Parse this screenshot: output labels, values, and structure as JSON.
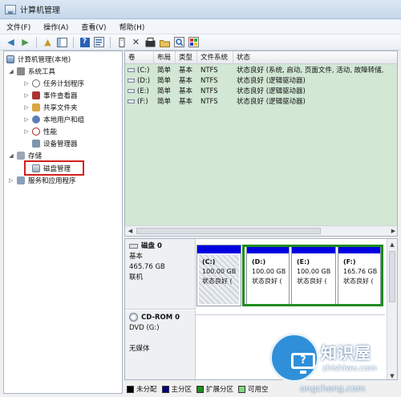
{
  "window": {
    "title": "计算机管理"
  },
  "menu": [
    "文件(F)",
    "操作(A)",
    "查看(V)",
    "帮助(H)"
  ],
  "toolbar": {
    "back": "back-arrow-icon",
    "forward": "forward-arrow-icon",
    "help_glyph": "?",
    "close_glyph": "✕"
  },
  "tree": {
    "root": "计算机管理(本地)",
    "system_tools": "系统工具",
    "task_scheduler": "任务计划程序",
    "event_viewer": "事件查看器",
    "shared_folders": "共享文件夹",
    "local_users": "本地用户和组",
    "performance": "性能",
    "device_manager": "设备管理器",
    "storage": "存储",
    "disk_management": "磁盘管理",
    "services": "服务和应用程序"
  },
  "volume_list": {
    "columns": [
      "卷",
      "布局",
      "类型",
      "文件系统",
      "状态"
    ],
    "rows": [
      {
        "volume": "(C:)",
        "layout": "简单",
        "type": "基本",
        "fs": "NTFS",
        "status": "状态良好 (系统, 启动, 页面文件, 活动, 故障转储,"
      },
      {
        "volume": "(D:)",
        "layout": "简单",
        "type": "基本",
        "fs": "NTFS",
        "status": "状态良好 (逻辑驱动器)"
      },
      {
        "volume": "(E:)",
        "layout": "简单",
        "type": "基本",
        "fs": "NTFS",
        "status": "状态良好 (逻辑驱动器)"
      },
      {
        "volume": "(F:)",
        "layout": "简单",
        "type": "基本",
        "fs": "NTFS",
        "status": "状态良好 (逻辑驱动器)"
      }
    ]
  },
  "disks": {
    "disk0": {
      "name": "磁盘 0",
      "type": "基本",
      "size": "465.76 GB",
      "state": "联机",
      "partitions": [
        {
          "name": "(C:)",
          "size": "100.00 GB",
          "status": "状态良好 ("
        },
        {
          "name": "(D:)",
          "size": "100.00 GB",
          "status": "状态良好 ("
        },
        {
          "name": "(E:)",
          "size": "100.00 GB",
          "status": "状态良好 ("
        },
        {
          "name": "(F:)",
          "size": "165.76 GB",
          "status": "状态良好 ("
        }
      ]
    },
    "cdrom0": {
      "name": "CD-ROM 0",
      "type": "DVD (G:)",
      "state": "无媒体"
    }
  },
  "legend": [
    {
      "label": "未分配",
      "color": "#000000"
    },
    {
      "label": "主分区",
      "color": "#000080"
    },
    {
      "label": "扩展分区",
      "color": "#1f8c1f"
    },
    {
      "label": "可用空",
      "color": "#7fd67f"
    }
  ],
  "watermark": {
    "brand": "知识屋",
    "url": "zhishiwu.com",
    "url2": "ongcheng.com"
  },
  "colors": {
    "volume_list_bg": "#d2e7d4",
    "primary_cap": "#0000e0",
    "extended_border": "#1f8c1f",
    "highlight": "#d2201a"
  }
}
